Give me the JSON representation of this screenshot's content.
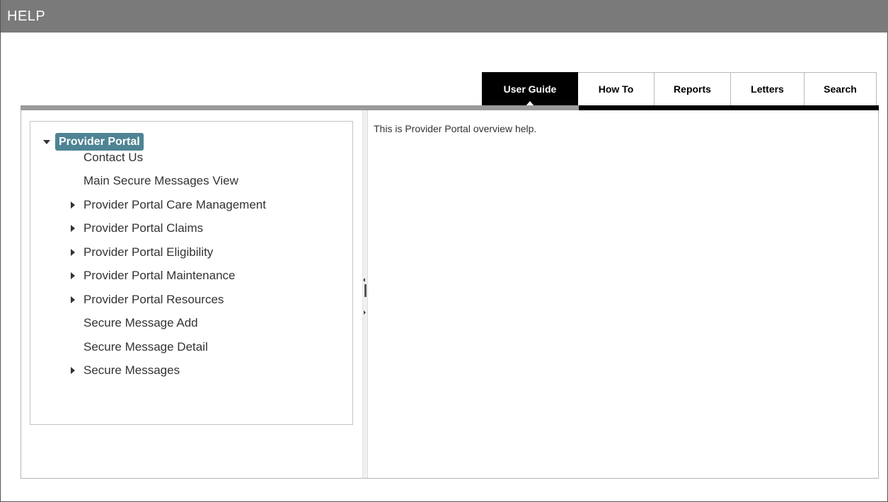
{
  "window": {
    "title": "HELP"
  },
  "tabs": [
    {
      "label": "User Guide",
      "active": true
    },
    {
      "label": "How To",
      "active": false
    },
    {
      "label": "Reports",
      "active": false
    },
    {
      "label": "Letters",
      "active": false
    },
    {
      "label": "Search",
      "active": false
    }
  ],
  "tree": {
    "root": {
      "label": "Provider Portal",
      "expanded": true,
      "icon": "caret-down-icon"
    },
    "items": [
      {
        "label": "Contact Us",
        "expandable": false
      },
      {
        "label": "Main Secure Messages View",
        "expandable": false
      },
      {
        "label": "Provider Portal Care Management",
        "expandable": true
      },
      {
        "label": "Provider Portal Claims",
        "expandable": true
      },
      {
        "label": "Provider Portal Eligibility",
        "expandable": true
      },
      {
        "label": "Provider Portal Maintenance",
        "expandable": true
      },
      {
        "label": "Provider Portal Resources",
        "expandable": true
      },
      {
        "label": "Secure Message Add",
        "expandable": false
      },
      {
        "label": "Secure Message Detail",
        "expandable": false
      },
      {
        "label": "Secure Messages",
        "expandable": true
      }
    ]
  },
  "content": {
    "text": "This is Provider Portal overview help."
  },
  "colors": {
    "titlebar": "#7a7a7a",
    "active_tab": "#000000",
    "selected_node": "#4e8494",
    "tab_underline_gray": "#9a9a9a"
  }
}
